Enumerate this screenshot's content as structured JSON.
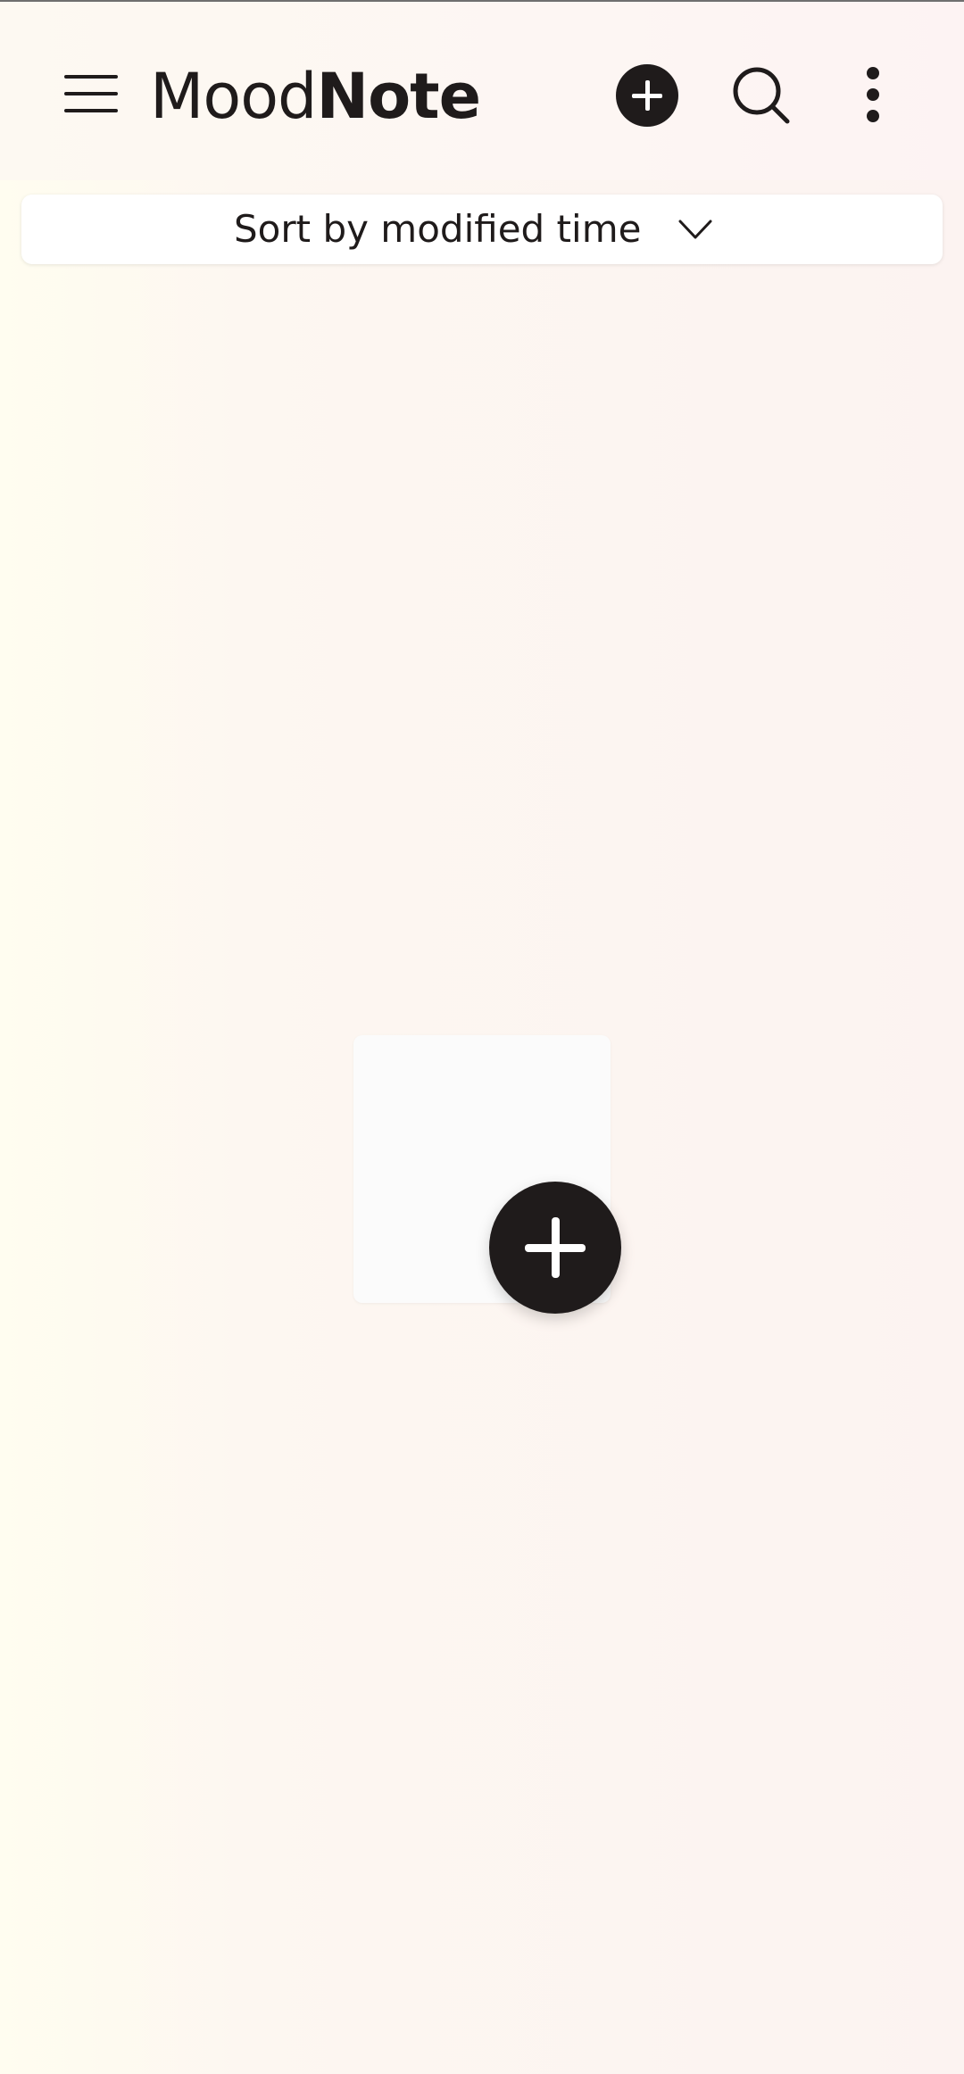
{
  "app": {
    "title_light": "Mood",
    "title_bold": "Note"
  },
  "toolbar": {
    "menu_icon": "hamburger-menu-icon",
    "add_icon": "add-circle-icon",
    "search_icon": "search-icon",
    "more_icon": "more-vertical-icon"
  },
  "sort": {
    "label": "Sort by modified time",
    "icon": "chevron-down-icon"
  },
  "empty_state": {
    "icon": "add-note-icon"
  },
  "colors": {
    "primary": "#1f1b1b",
    "background_start": "#fffdf0",
    "background_end": "#fcf3f1",
    "card": "#ffffff"
  }
}
